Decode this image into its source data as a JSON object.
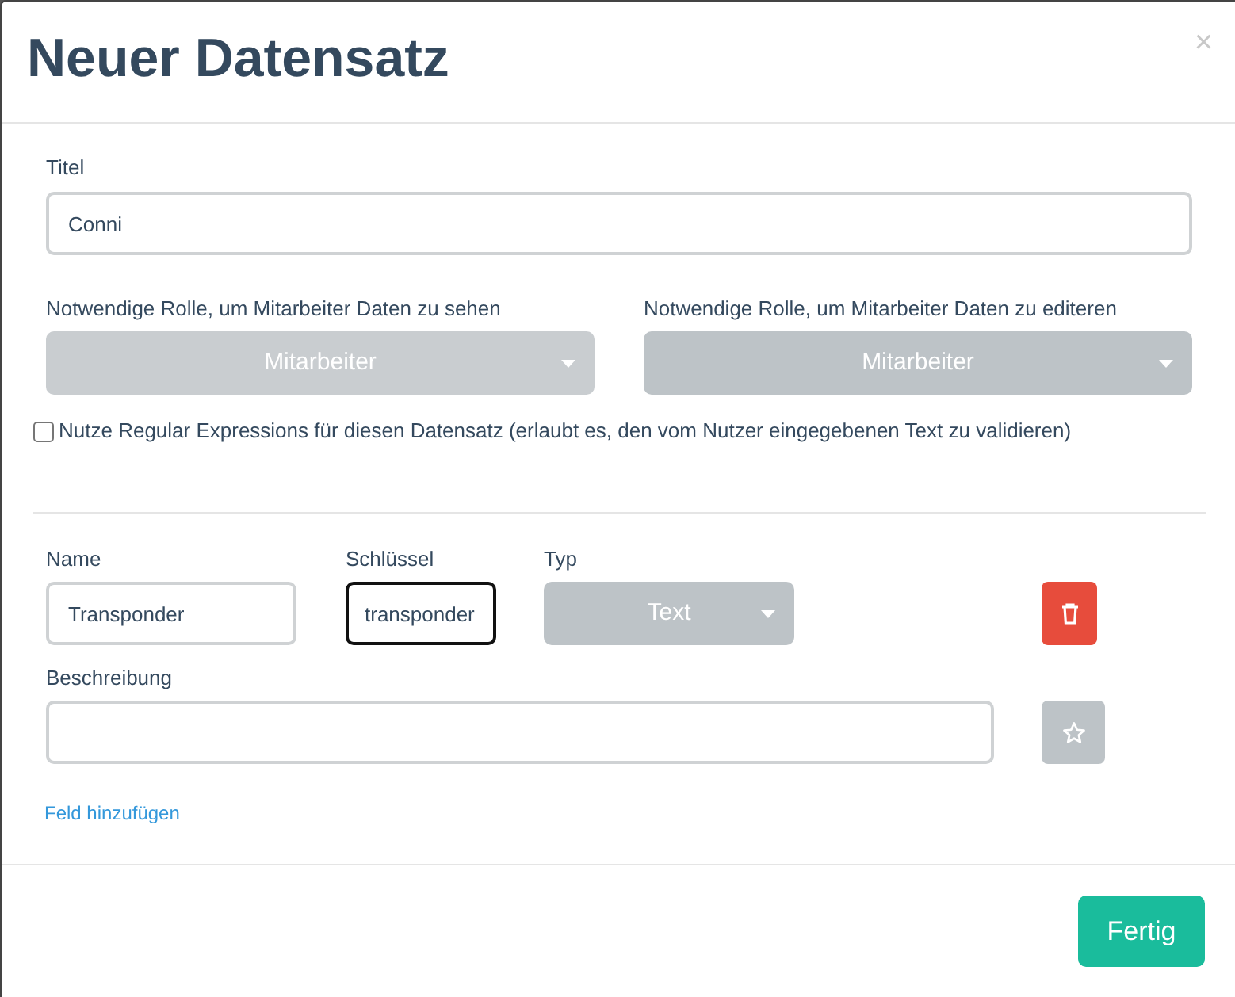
{
  "dialog": {
    "title": "Neuer Datensatz",
    "close": "×"
  },
  "title_field": {
    "label": "Titel",
    "value": "Conni"
  },
  "roles": [
    {
      "label": "Notwendige Rolle, um Mitarbeiter Daten zu sehen",
      "value": "Mitarbeiter"
    },
    {
      "label": "Notwendige Rolle, um Mitarbeiter Daten zu editeren",
      "value": "Mitarbeiter"
    }
  ],
  "regex_option": {
    "label": "Nutze Regular Expressions für diesen Datensatz (erlaubt es, den vom Nutzer eingegebenen Text zu validieren)",
    "checked": false
  },
  "fields": [
    {
      "name_label": "Name",
      "name": "Transponder",
      "key_label": "Schlüssel",
      "key": "transponder",
      "key_focused": true,
      "type_label": "Typ",
      "type": "Text",
      "description_label": "Beschreibung"
    }
  ],
  "add_field_link": "Feld hinzufügen",
  "footer": {
    "done_button": "Fertig"
  }
}
